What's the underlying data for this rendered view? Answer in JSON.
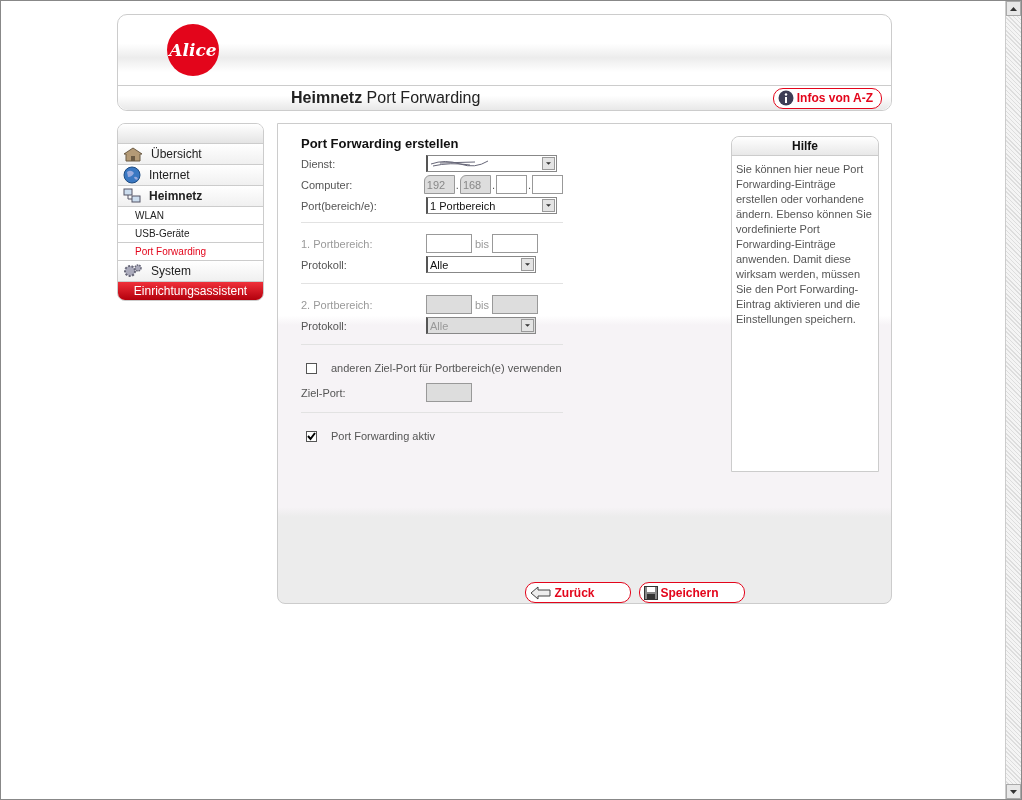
{
  "header": {
    "logo": "Alice",
    "title_bold": "Heimnetz",
    "title": "Port Forwarding",
    "info_button": "Infos von A-Z"
  },
  "sidebar": {
    "items": [
      {
        "label": "Übersicht",
        "kind": "main",
        "selected": false
      },
      {
        "label": "Internet",
        "kind": "main",
        "selected": false
      },
      {
        "label": "Heimnetz",
        "kind": "main",
        "selected": true
      },
      {
        "label": "WLAN",
        "kind": "sub",
        "selected": false
      },
      {
        "label": "USB-Geräte",
        "kind": "sub",
        "selected": false
      },
      {
        "label": "Port Forwarding",
        "kind": "sub",
        "selected": true
      },
      {
        "label": "System",
        "kind": "main",
        "selected": false
      }
    ],
    "wizard_button": "Einrichtungsassistent"
  },
  "form": {
    "title": "Port Forwarding erstellen",
    "sections": [
      {
        "rows": [
          {
            "kind": "select",
            "label": "Dienst:",
            "obscured": true,
            "disabled": false
          },
          {
            "kind": "ip",
            "label": "Computer:",
            "separator": ".",
            "parts": [
              {
                "value": "192",
                "disabled": true
              },
              {
                "value": "168",
                "disabled": true
              },
              {
                "disabled": false
              },
              {
                "disabled": false
              }
            ]
          },
          {
            "kind": "select",
            "label": "Port(bereich/e):",
            "value": "1 Portbereich",
            "disabled": false
          }
        ]
      },
      {
        "rows": [
          {
            "kind": "range",
            "label": "1. Portbereich:",
            "separator": "bis",
            "disabled": false
          },
          {
            "kind": "select",
            "label": "Protokoll:",
            "value": "Alle",
            "disabled": false
          }
        ]
      },
      {
        "rows": [
          {
            "kind": "range",
            "label": "2. Portbereich:",
            "separator": "bis",
            "disabled": true
          },
          {
            "kind": "select",
            "label": "Protokoll:",
            "value": "Alle",
            "disabled": true
          }
        ]
      },
      {
        "rows": [
          {
            "kind": "checkbox",
            "label": "anderen Ziel-Port für Portbereich(e) verwenden",
            "checked": false
          },
          {
            "kind": "text",
            "label": "Ziel-Port:",
            "disabled": true
          }
        ]
      },
      {
        "rows": [
          {
            "kind": "checkbox",
            "label": "Port Forwarding aktiv",
            "checked": true
          }
        ]
      }
    ]
  },
  "help": {
    "title": "Hilfe",
    "text": "Sie können hier neue Port Forwarding-Einträge erstellen oder vorhandene ändern. Ebenso können Sie vordefinierte Port Forwarding-Einträge anwenden. Damit diese wirksam werden, müssen Sie den Port Forwarding-Eintrag aktivieren und die Einstellungen speichern."
  },
  "buttons": [
    {
      "label": "Zurück"
    },
    {
      "label": "Speichern"
    }
  ]
}
